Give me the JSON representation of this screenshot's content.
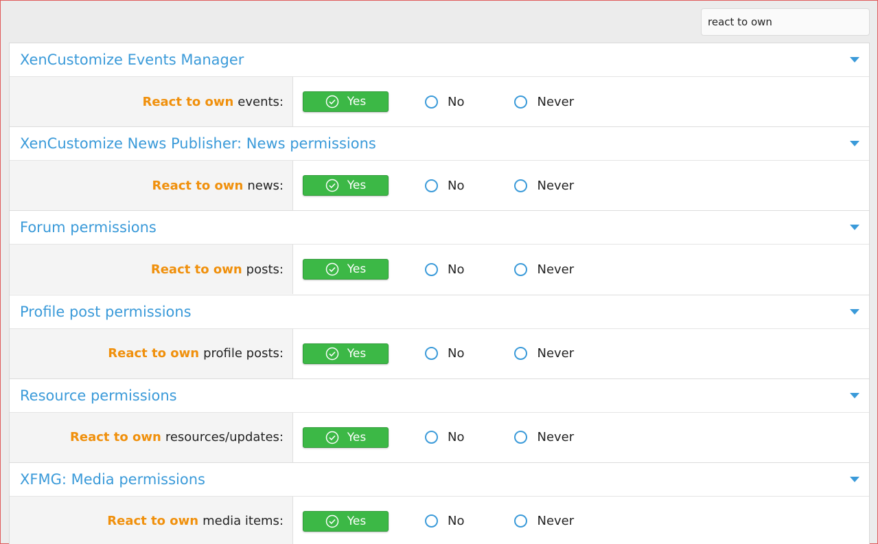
{
  "search": {
    "value": "react to own"
  },
  "highlight": "React to own",
  "options": {
    "yes": "Yes",
    "no": "No",
    "never": "Never"
  },
  "colors": {
    "link": "#3a9ad9",
    "highlight": "#f0900c",
    "yes": "#3cb846"
  },
  "sections": [
    {
      "title": "XenCustomize Events Manager",
      "label_rest": "events:"
    },
    {
      "title": "XenCustomize News Publisher: News permissions",
      "label_rest": "news:"
    },
    {
      "title": "Forum permissions",
      "label_rest": "posts:"
    },
    {
      "title": "Profile post permissions",
      "label_rest": "profile posts:"
    },
    {
      "title": "Resource permissions",
      "label_rest": "resources/updates:"
    },
    {
      "title": "XFMG: Media permissions",
      "label_rest": "media items:"
    }
  ]
}
